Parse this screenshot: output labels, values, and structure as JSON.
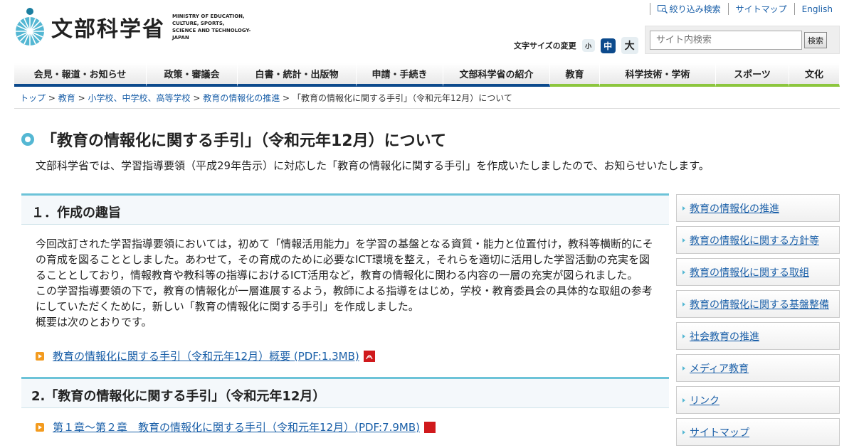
{
  "header": {
    "logo_text": "文部科学省",
    "logo_en_lines": [
      "MINISTRY OF EDUCATION,",
      "CULTURE, SPORTS,",
      "SCIENCE AND TECHNOLOGY-JAPAN"
    ],
    "top_links": [
      "絞り込み検索",
      "サイトマップ",
      "English"
    ],
    "fontsize_label": "文字サイズの変更",
    "fontsize_small": "小",
    "fontsize_medium": "中",
    "fontsize_large": "大",
    "search_placeholder": "サイト内検索",
    "search_button": "検索"
  },
  "nav": {
    "items": [
      {
        "label": "会見・報道・お知らせ",
        "color": "blue"
      },
      {
        "label": "政策・審議会",
        "color": "blue"
      },
      {
        "label": "白書・統計・出版物",
        "color": "blue"
      },
      {
        "label": "申請・手続き",
        "color": "blue"
      },
      {
        "label": "文部科学省の紹介",
        "color": "blue"
      },
      {
        "label": "教育",
        "color": "green"
      },
      {
        "label": "科学技術・学術",
        "color": "green"
      },
      {
        "label": "スポーツ",
        "color": "green"
      },
      {
        "label": "文化",
        "color": "green"
      }
    ]
  },
  "breadcrumb": {
    "items": [
      "トップ",
      "教育",
      "小学校、中学校、高等学校",
      "教育の情報化の推進"
    ],
    "separator": ">",
    "current": "「教育の情報化に関する手引」（令和元年12月）について"
  },
  "page": {
    "title": "「教育の情報化に関する手引」（令和元年12月）について",
    "intro": "文部科学省では、学習指導要領（平成29年告示）に対応した「教育の情報化に関する手引」を作成いたしましたので、お知らせいたします。"
  },
  "sections": {
    "s1_heading": "１．作成の趣旨",
    "s1_p1": "今回改訂された学習指導要領においては，初めて「情報活用能力」を学習の基盤となる資質・能力と位置付け，教科等横断的にその育成を図ることとしました。あわせて，その育成のために必要なICT環境を整え，それらを適切に活用した学習活動の充実を図ることとしており，情報教育や教科等の指導におけるICT活用など，教育の情報化に関わる内容の一層の充実が図られました。",
    "s1_p2": "この学習指導要領の下で，教育の情報化が一層進展するよう，教師による指導をはじめ，学校・教育委員会の具体的な取組の参考にしていただくために，新しい「教育の情報化に関する手引」を作成しました。",
    "s1_p3": "概要は次のとおりです。",
    "s1_link": "教育の情報化に関する手引（令和元年12月）概要 (PDF:1.3MB)",
    "s2_heading": "2.「教育の情報化に関する手引」（令和元年12月）",
    "s2_link": "第１章〜第２章　教育の情報化に関する手引（令和元年12月）(PDF:7.9MB)"
  },
  "sidebar": {
    "items": [
      "教育の情報化の推進",
      "教育の情報化に関する方針等",
      "教育の情報化に関する取組",
      "教育の情報化に関する基盤整備",
      "社会教育の推進",
      "メディア教育",
      "リンク",
      "サイトマップ"
    ]
  },
  "colors": {
    "accent_blue": "#0c4a8c",
    "accent_green": "#8cc63e",
    "section_border": "#6cc3d8",
    "link": "#1a5fa8"
  }
}
